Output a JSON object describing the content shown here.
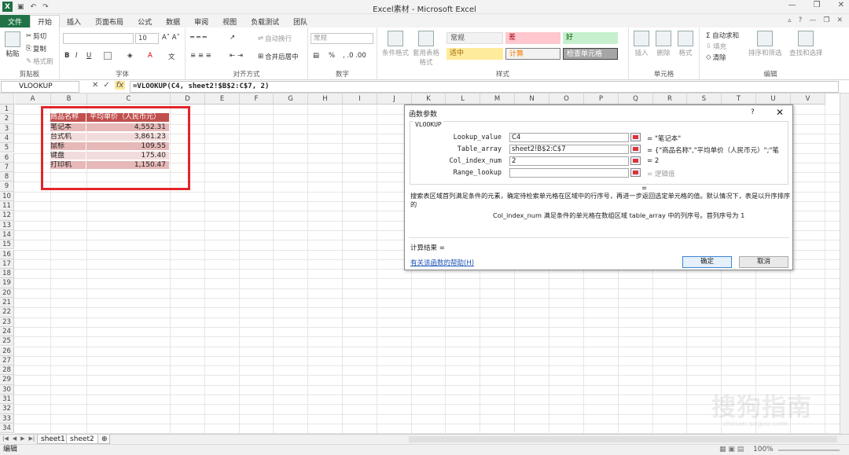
{
  "window": {
    "title": "Excel素材 - Microsoft Excel",
    "logo": "X",
    "qa_icons": [
      "save-icon",
      "undo-icon",
      "redo-icon"
    ]
  },
  "tabs": [
    "文件",
    "开始",
    "插入",
    "页面布局",
    "公式",
    "数据",
    "审阅",
    "视图",
    "负载测试",
    "团队"
  ],
  "ribbon": {
    "clipboard": {
      "paste": "粘贴",
      "cut": "剪切",
      "copy": "复制",
      "painter": "格式刷",
      "label": "剪贴板"
    },
    "font": {
      "size": "10",
      "label": "字体",
      "bold": "B",
      "italic": "I",
      "underline": "U"
    },
    "alignment": {
      "wrap": "自动换行",
      "merge": "合并后居中",
      "label": "对齐方式"
    },
    "number": {
      "format": "常规",
      "label": "数字",
      "percent": "%"
    },
    "styles": {
      "conditional": "条件格式",
      "table": "套用表格格式",
      "cells": [
        "常规",
        "差",
        "好",
        "适中",
        "计算",
        "检查单元格"
      ],
      "label": "样式"
    },
    "cells": {
      "insert": "插入",
      "delete": "删除",
      "format": "格式",
      "label": "单元格"
    },
    "editing": {
      "autosum": "Σ 自动求和",
      "fill": "填充",
      "clear": "清除",
      "sort": "排序和筛选",
      "find": "查找和选择",
      "label": "编辑"
    }
  },
  "formula_bar": {
    "name_box": "VLOOKUP",
    "formula": "=VLOOKUP(C4, sheet2!$B$2:C$7, 2)"
  },
  "columns": [
    "A",
    "B",
    "C",
    "D",
    "E",
    "F",
    "G",
    "H",
    "I",
    "J",
    "K",
    "L",
    "M",
    "N",
    "O",
    "P",
    "Q",
    "R",
    "S",
    "T",
    "U",
    "V"
  ],
  "rows": [
    "1",
    "2",
    "3",
    "4",
    "5",
    "6",
    "7",
    "8",
    "9",
    "10",
    "11",
    "12",
    "13",
    "14",
    "15",
    "16",
    "17",
    "18",
    "19",
    "20",
    "21",
    "22",
    "23",
    "24",
    "25",
    "26",
    "27",
    "28",
    "29",
    "30",
    "31",
    "32",
    "33",
    "34"
  ],
  "table": {
    "header": [
      "商品名称",
      "平均单价（人民币元）"
    ],
    "rows": [
      [
        "笔记本",
        "4,552.31"
      ],
      [
        "台式机",
        "3,861.23"
      ],
      [
        "鼠标",
        "109.55"
      ],
      [
        "键盘",
        "175.40"
      ],
      [
        "打印机",
        "1,150.47"
      ]
    ],
    "header_color": "#c0504d",
    "row_colors": [
      "#e6b8b7",
      "#f2dcdb"
    ],
    "highlight_color": "#e2252b"
  },
  "dialog": {
    "title": "函数参数",
    "help": "?",
    "function_name": "VLOOKUP",
    "args": [
      {
        "label": "Lookup_value",
        "value": "C4",
        "result": "=  \"笔记本\""
      },
      {
        "label": "Table_array",
        "value": "sheet2!B$2:C$7",
        "result": "=  {\"商品名称\",\"平均单价（人民币元）\";\"笔"
      },
      {
        "label": "Col_index_num",
        "value": "2",
        "result": "=  2"
      },
      {
        "label": "Range_lookup",
        "value": "",
        "result": "=  逻辑值"
      }
    ],
    "eq": "=",
    "description": "搜索表区域首列满足条件的元素，确定待检索单元格在区域中的行序号，再进一步返回选定单元格的值。默认情况下，表是以升序排序的",
    "arg_description": "Col_index_num  满足条件的单元格在数组区域 table_array 中的列序号。首列序号为 1",
    "result_label": "计算结果 =",
    "help_link": "有关该函数的帮助(H)",
    "ok": "确定",
    "cancel": "取消"
  },
  "sheets": [
    "sheet1",
    "sheet2"
  ],
  "status": {
    "mode": "编辑",
    "zoom": "100%"
  },
  "watermark": "搜狗指南",
  "watermark_sub": "zhinan.sogou.com"
}
